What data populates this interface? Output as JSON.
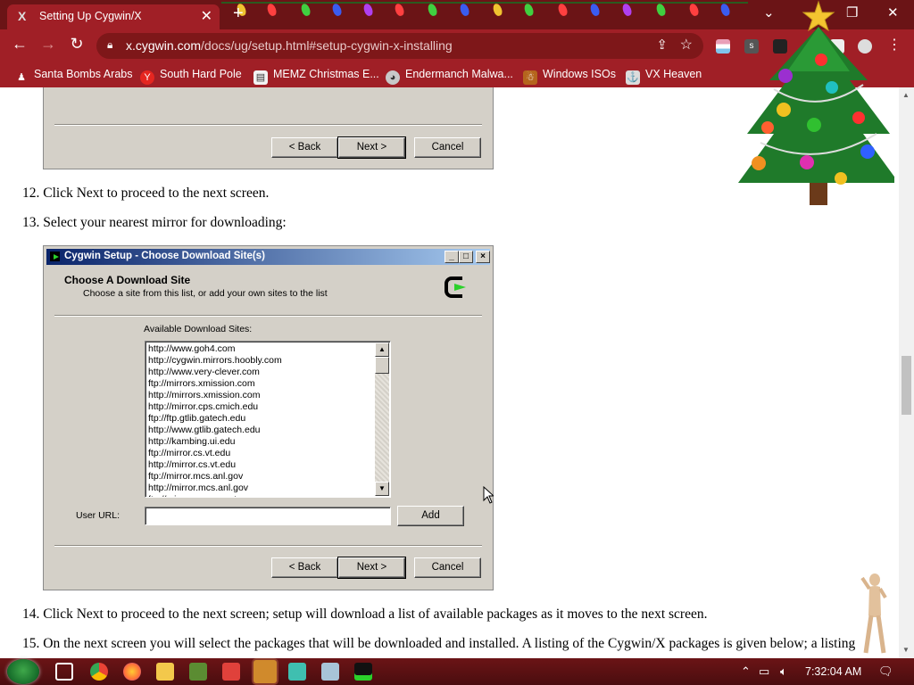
{
  "browser": {
    "tab_title": "Setting Up Cygwin/X",
    "tab_favicon": "X",
    "tab_close": "✕",
    "new_tab": "+",
    "url_host": "x.cygwin.com",
    "url_path": "/docs/ug/setup.html#setup-cygwin-x-installing",
    "window_controls": {
      "minimize": "⌄",
      "restore": "—",
      "maximize": "❐",
      "close": "✕"
    },
    "nav": {
      "back": "←",
      "forward": "→",
      "reload": "↻",
      "share": "⇪",
      "star": "☆",
      "menu": "⋮"
    }
  },
  "bookmarks": [
    {
      "label": "Santa Bombs Arabs",
      "icon": "figure-icon",
      "color": "#a01f26",
      "glyph": "♟"
    },
    {
      "label": "South Hard Pole",
      "icon": "yandex-icon",
      "color": "#e52620",
      "glyph": "Y"
    },
    {
      "label": "MEMZ Christmas E...",
      "icon": "page-icon",
      "color": "#f2f2f2",
      "glyph": "▤"
    },
    {
      "label": "Endermanch Malwa...",
      "icon": "raccoon-icon",
      "color": "#c8c8c8",
      "glyph": "◕"
    },
    {
      "label": "Windows ISOs",
      "icon": "gingerbread-icon",
      "color": "#b5651d",
      "glyph": "☃"
    },
    {
      "label": "VX Heaven",
      "icon": "ship-icon",
      "color": "#dcdcdc",
      "glyph": "⚓"
    }
  ],
  "top_dialog": {
    "back": "< Back",
    "next": "Next >",
    "cancel": "Cancel"
  },
  "steps": [
    {
      "num": "12.",
      "text": "Click Next to proceed to the next screen."
    },
    {
      "num": "13.",
      "text": "Select your nearest mirror for downloading:"
    },
    {
      "num": "14.",
      "text": "Click Next to proceed to the next screen; setup will download a list of available packages as it moves to the next screen."
    },
    {
      "num": "15.",
      "text": "On the next screen you will select the packages that will be downloaded and installed. A listing of the Cygwin/X packages is given below; a listing"
    }
  ],
  "dialog": {
    "title": "Cygwin Setup - Choose Download Site(s)",
    "caption_buttons": [
      "_",
      "□",
      "×"
    ],
    "heading": "Choose A Download Site",
    "subheading": "Choose a site from this list, or add your own sites to the list",
    "sites_label": "Available Download Sites:",
    "sites": [
      "http://www.goh4.com",
      "http://cygwin.mirrors.hoobly.com",
      "http://www.very-clever.com",
      "ftp://mirrors.xmission.com",
      "http://mirrors.xmission.com",
      "http://mirror.cps.cmich.edu",
      "ftp://ftp.gtlib.gatech.edu",
      "http://www.gtlib.gatech.edu",
      "http://kambing.ui.edu",
      "ftp://mirror.cs.vt.edu",
      "http://mirror.cs.vt.edu",
      "ftp://mirror.mcs.anl.gov",
      "http://mirror.mcs.anl.gov",
      "ftp://mirror.averse.net"
    ],
    "user_url_label": "User URL:",
    "user_url_value": "",
    "add": "Add",
    "back": "< Back",
    "next": "Next >",
    "cancel": "Cancel"
  },
  "taskbar": {
    "clock": "7:32:04 AM",
    "apps": [
      {
        "name": "task-view-icon",
        "color": "#ffffff"
      },
      {
        "name": "chrome-icon",
        "color": "#4285f4"
      },
      {
        "name": "firefox-icon",
        "color": "#ff7139"
      },
      {
        "name": "file-explorer-icon",
        "color": "#f3c84b"
      },
      {
        "name": "minecraft-icon",
        "color": "#5b8c32"
      },
      {
        "name": "app-red-icon",
        "color": "#e0413b"
      },
      {
        "name": "box-icon",
        "color": "#d08a2c"
      },
      {
        "name": "app-teal-icon",
        "color": "#3fbfb0"
      },
      {
        "name": "display-icon",
        "color": "#a8c4d8"
      },
      {
        "name": "cygwin-terminal-icon",
        "color": "#2bd12b"
      }
    ]
  }
}
